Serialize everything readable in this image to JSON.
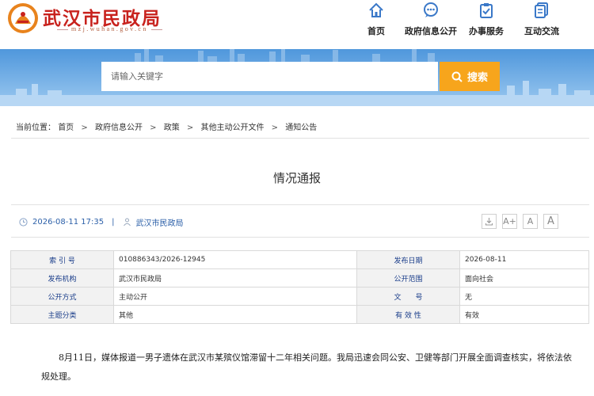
{
  "header": {
    "site_title": "武汉市民政局",
    "site_domain": "mzj.wuhan.gov.cn",
    "logo_icon": "wuhan-civil-affairs-logo",
    "nav": [
      {
        "label": "首页",
        "icon": "home-icon"
      },
      {
        "label": "政府信息公开",
        "icon": "chat-icon"
      },
      {
        "label": "办事服务",
        "icon": "clipboard-icon"
      },
      {
        "label": "互动交流",
        "icon": "document-icon"
      }
    ]
  },
  "search": {
    "placeholder": "请输入关键字",
    "button_label": "搜索"
  },
  "breadcrumb": {
    "prefix": "当前位置：",
    "items": [
      "首页",
      "政府信息公开",
      "政策",
      "其他主动公开文件",
      "通知公告"
    ],
    "separator": ">"
  },
  "article": {
    "title": "情况通报",
    "datetime": "2026-08-11 17:35",
    "source": "武汉市民政局",
    "tools": [
      "下载",
      "A+",
      "A",
      "A"
    ]
  },
  "info_table": {
    "rows": [
      [
        {
          "k": "索 引 号",
          "v": "010886343/2026-12945"
        },
        {
          "k": "发布日期",
          "v": "2026-08-11"
        }
      ],
      [
        {
          "k": "发布机构",
          "v": "武汉市民政局"
        },
        {
          "k": "公开范围",
          "v": "面向社会"
        }
      ],
      [
        {
          "k": "公开方式",
          "v": "主动公开"
        },
        {
          "k": "文　　号",
          "v": "无"
        }
      ],
      [
        {
          "k": "主题分类",
          "v": "其他"
        },
        {
          "k": "有 效 性",
          "v": "有效"
        }
      ]
    ]
  },
  "body": {
    "paragraph": "8月11日，媒体报道一男子遗体在武汉市某殡仪馆滞留十二年相关问题。我局迅速会同公安、卫健等部门开展全面调查核实，将依法依规处理。"
  },
  "colors": {
    "brand_red": "#c8221d",
    "banner_blue": "#5aa0e0",
    "search_orange": "#f7a51c",
    "link_blue": "#2b5fa8",
    "table_key_blue": "#1a3d8a"
  }
}
